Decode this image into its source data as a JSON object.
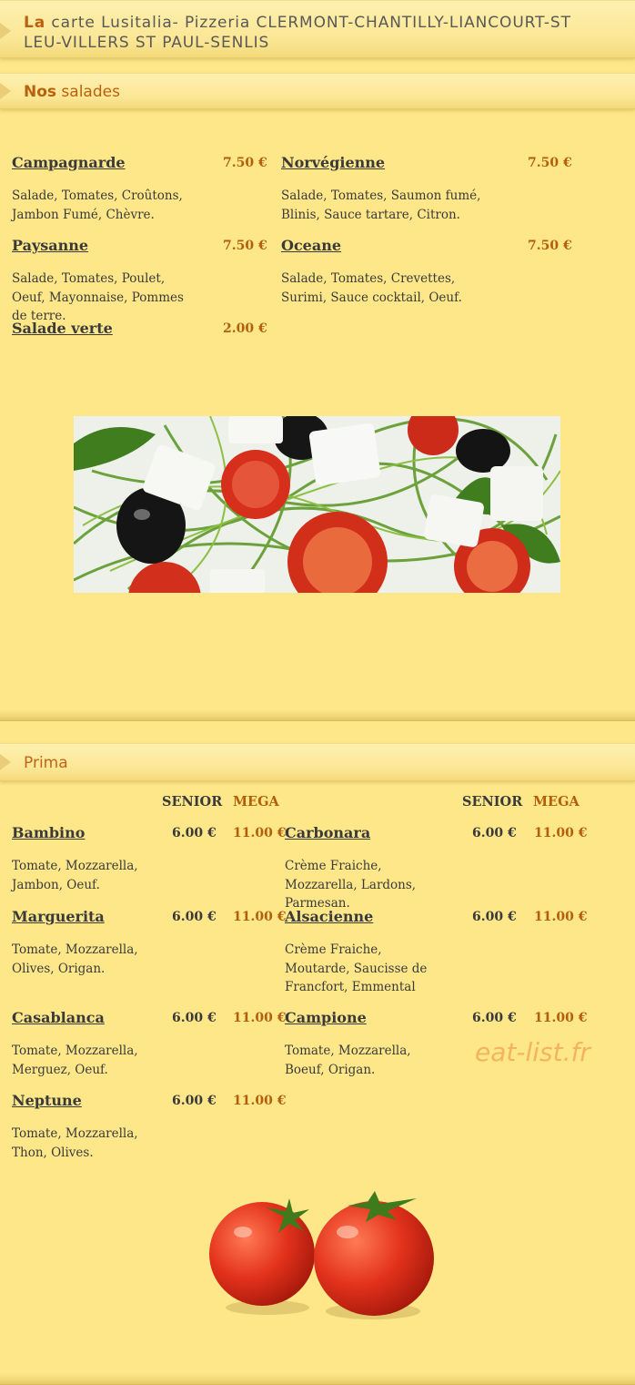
{
  "header": {
    "title_accent": "La",
    "title_rest": " carte Lusitalia- Pizzeria CLERMONT-CHANTILLY-LIANCOURT-ST LEU-VILLERS ST PAUL-SENLIS"
  },
  "salades": {
    "title_accent": "Nos",
    "title_rest": " salades",
    "items": [
      {
        "name": "Campagnarde",
        "price": "7.50 €",
        "desc": "Salade, Tomates, Croûtons, Jambon Fumé, Chèvre."
      },
      {
        "name": "Norvégienne",
        "price": "7.50 €",
        "desc": "Salade, Tomates, Saumon fumé, Blinis, Sauce tartare, Citron."
      },
      {
        "name": "Paysanne",
        "price": "7.50 €",
        "desc": "Salade, Tomates, Poulet, Oeuf, Mayonnaise, Pommes de terre."
      },
      {
        "name": "Oceane",
        "price": "7.50 €",
        "desc": "Salade, Tomates, Crevettes, Surimi, Sauce cocktail, Oeuf."
      },
      {
        "name": "Salade verte",
        "price": "2.00 €",
        "desc": ""
      }
    ]
  },
  "prima": {
    "title": "Prima",
    "col_senior": "SENIOR",
    "col_mega": "MEGA",
    "items": [
      {
        "name": "Bambino",
        "senior": "6.00 €",
        "mega": "11.00 €",
        "desc": "Tomate, Mozzarella, Jambon, Oeuf."
      },
      {
        "name": "Carbonara",
        "senior": "6.00 €",
        "mega": "11.00 €",
        "desc": "Crème Fraiche, Mozzarella, Lardons, Parmesan."
      },
      {
        "name": "Marguerita",
        "senior": "6.00 €",
        "mega": "11.00 €",
        "desc": "Tomate, Mozzarella, Olives, Origan."
      },
      {
        "name": "Alsacienne",
        "senior": "6.00 €",
        "mega": "11.00 €",
        "desc": "Crème Fraiche, Moutarde, Saucisse de Francfort, Emmental"
      },
      {
        "name": "Casablanca",
        "senior": "6.00 €",
        "mega": "11.00 €",
        "desc": "Tomate, Mozzarella, Merguez, Oeuf."
      },
      {
        "name": "Campione",
        "senior": "6.00 €",
        "mega": "11.00 €",
        "desc": "Tomate, Mozzarella, Boeuf, Origan."
      },
      {
        "name": "Neptune",
        "senior": "6.00 €",
        "mega": "11.00 €",
        "desc": "Tomate, Mozzarella, Thon, Olives."
      }
    ]
  },
  "watermark": "eat-list.fr"
}
